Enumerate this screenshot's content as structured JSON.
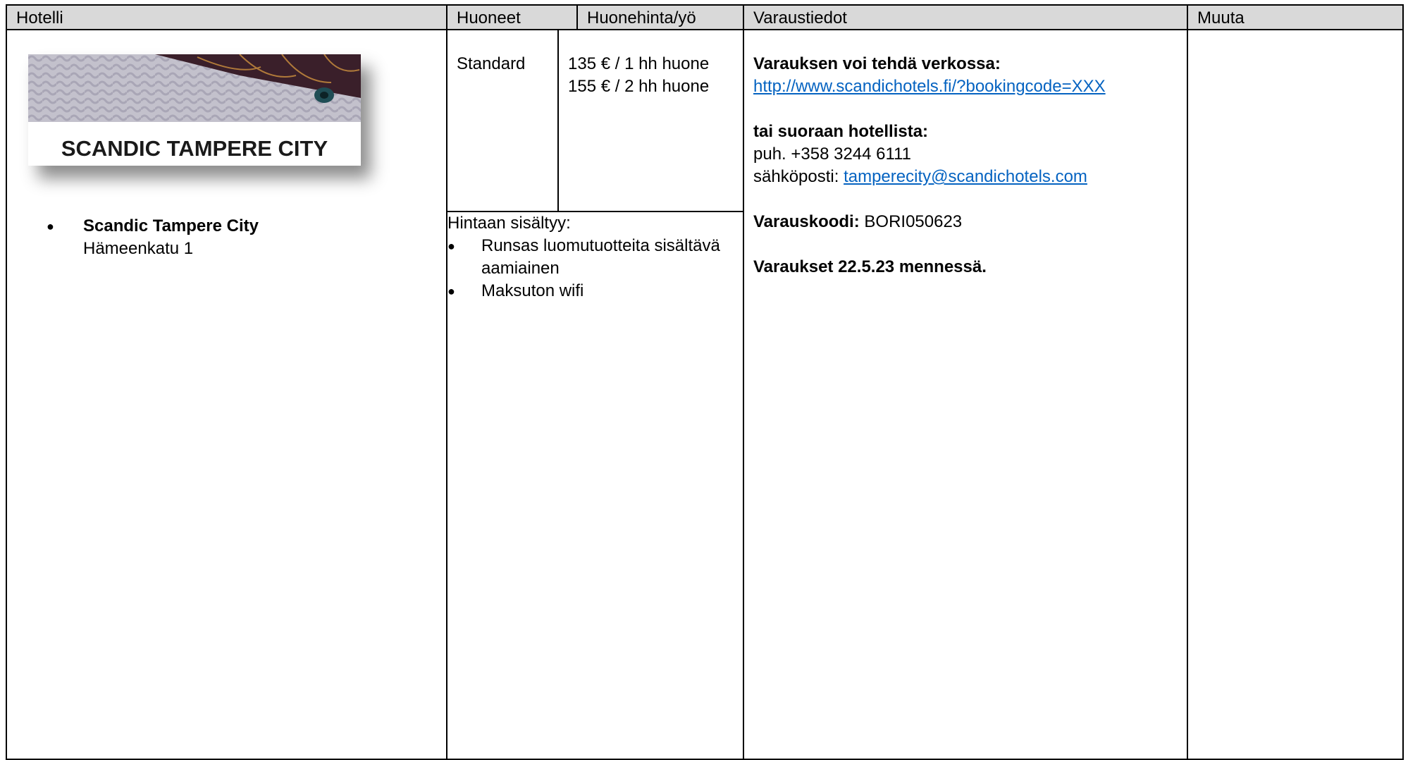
{
  "headers": {
    "hotel": "Hotelli",
    "rooms": "Huoneet",
    "price": "Huonehinta/yö",
    "booking": "Varaustiedot",
    "other": "Muuta"
  },
  "hotel": {
    "logo_text": "SCANDIC TAMPERE CITY",
    "name": "Scandic Tampere City",
    "address": "Hämeenkatu 1"
  },
  "rooms": {
    "type": "Standard",
    "price_single": "135 € / 1 hh huone",
    "price_double": "155 € / 2 hh huone",
    "includes_label": "Hintaan sisältyy:",
    "includes": [
      "Runsas luomutuotteita sisältävä aamiainen",
      "Maksuton wifi"
    ]
  },
  "booking": {
    "online_label": "Varauksen voi tehdä verkossa:",
    "online_url": "http://www.scandichotels.fi/?bookingcode=XXX",
    "direct_label": "tai suoraan hotellista:",
    "phone": "puh. +358 3244 6111",
    "email_label": "sähköposti:",
    "email": "tamperecity@scandichotels.com",
    "code_label": "Varauskoodi:",
    "code": "BORI050623",
    "deadline": "Varaukset 22.5.23 mennessä."
  },
  "other": {},
  "colors": {
    "header_bg": "#d9d9d9",
    "link": "#0563c1",
    "logo_band": "#b8b8c4",
    "logo_dark": "#3a1f2a"
  }
}
